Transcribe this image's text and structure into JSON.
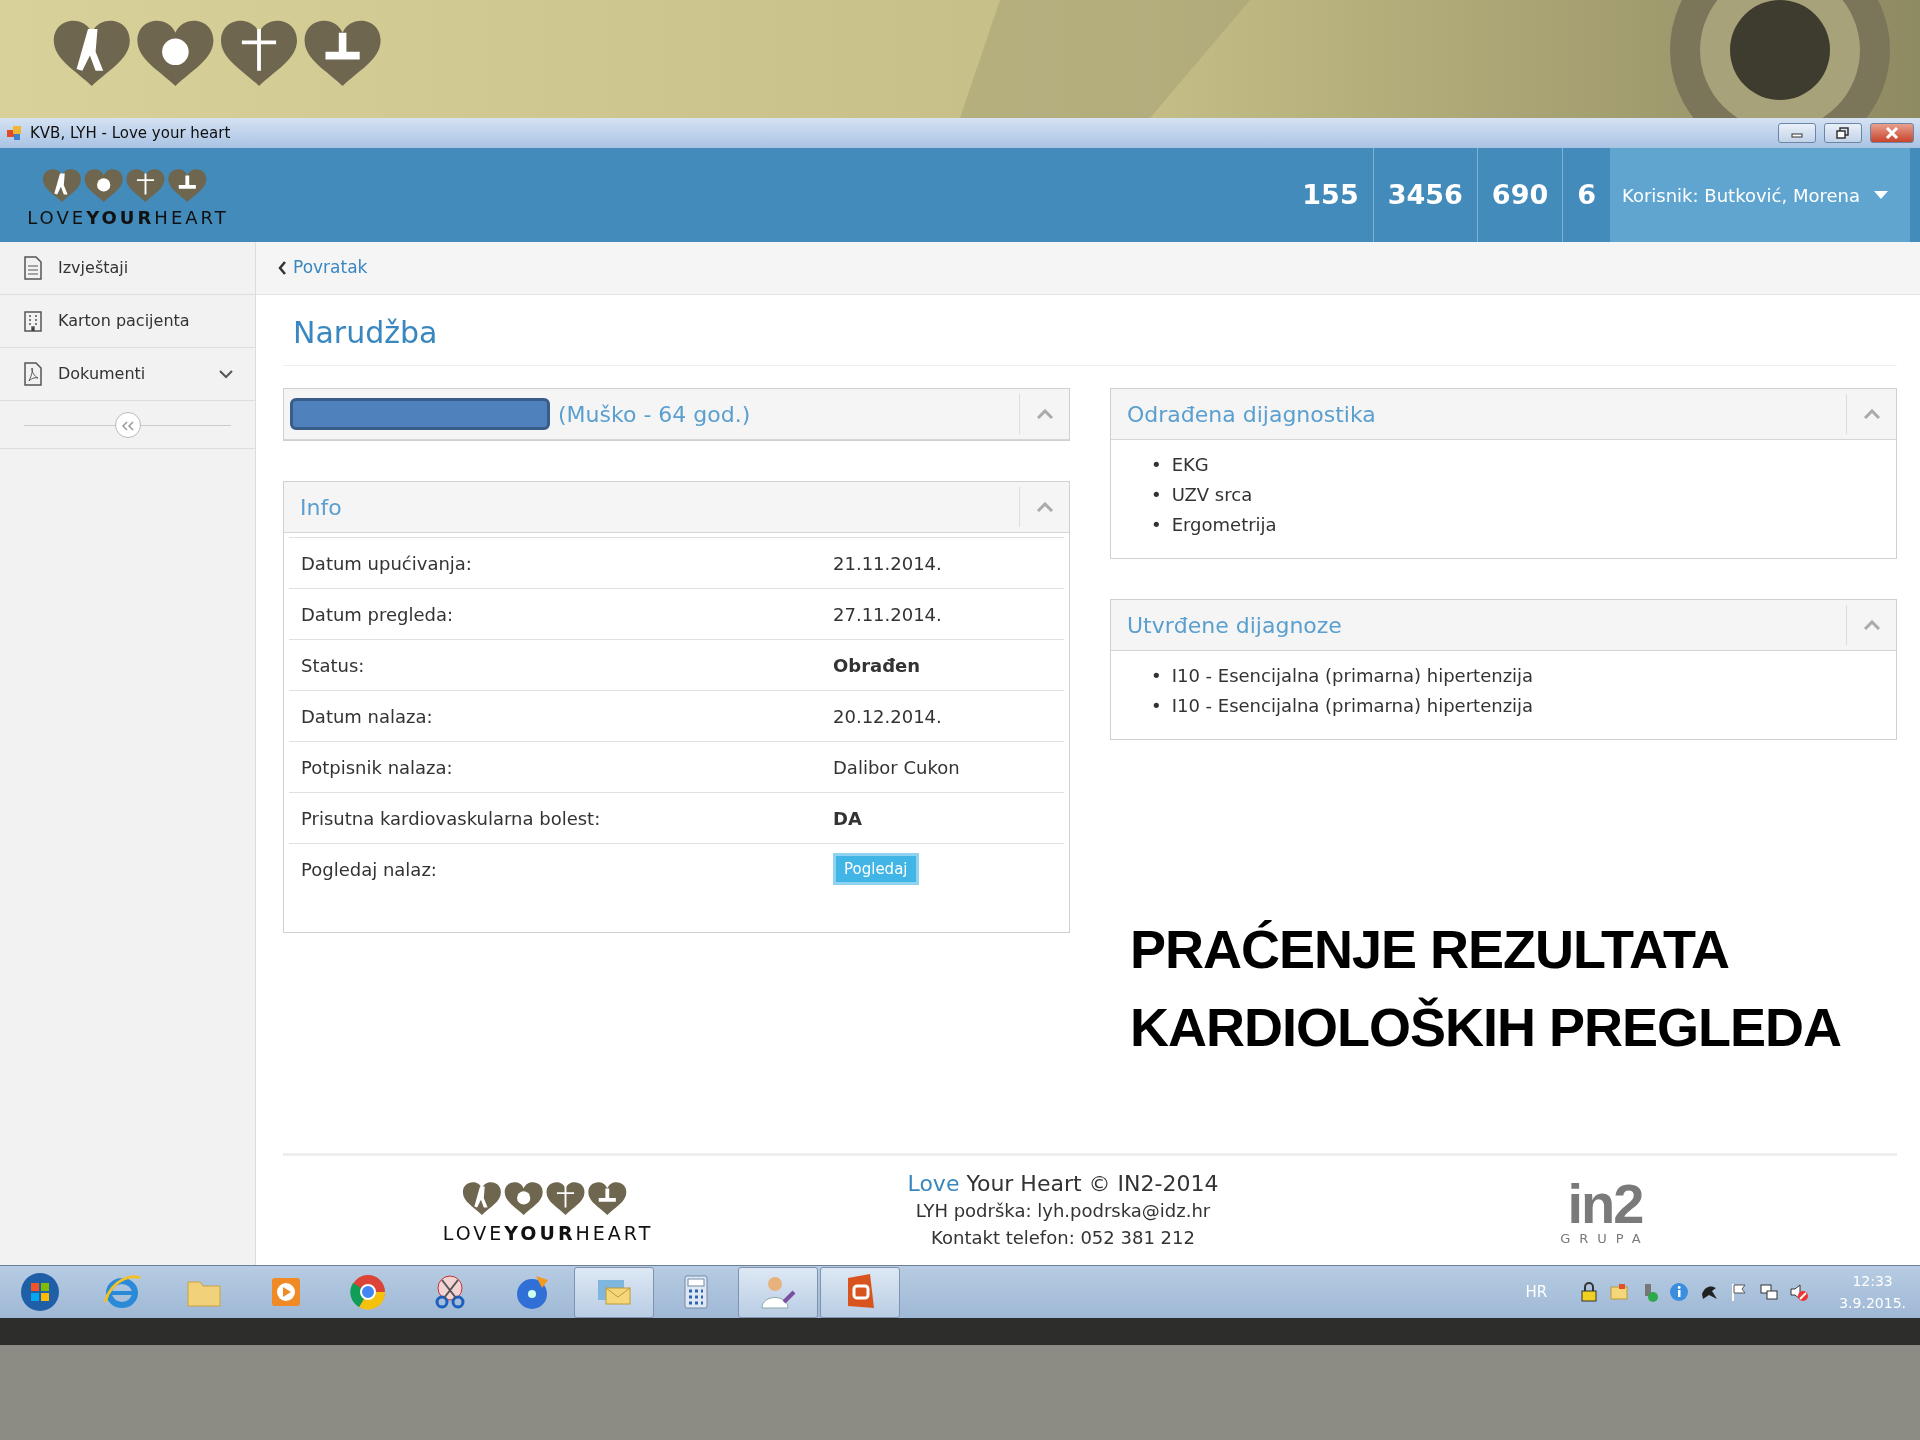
{
  "slide": {
    "caption_lines": [
      "PRAĆENJE REZULTATA",
      "KARDIOLOŠKIH PREGLEDA"
    ]
  },
  "window": {
    "title": "KVB, LYH - Love your heart"
  },
  "header": {
    "logo": "LOVE**YOUR**HEART",
    "counters": [
      "155",
      "3456",
      "690",
      "6"
    ],
    "user": "Korisnik: Butković, Morena"
  },
  "sidebar": {
    "items": [
      {
        "label": "Izvještaji",
        "kind": "document",
        "expandable": false
      },
      {
        "label": "Karton pacijenta",
        "kind": "building",
        "expandable": false
      },
      {
        "label": "Dokumenti",
        "kind": "pdf",
        "expandable": true
      }
    ]
  },
  "breadcrumb": {
    "back": "Povratak"
  },
  "page_title": "Narudžba",
  "patient_panel": {
    "subtitle": "(Muško - 64 god.)"
  },
  "info_panel": {
    "title": "Info",
    "rows": [
      {
        "label": "Datum upućivanja:",
        "value": "21.11.2014.",
        "kind": "text"
      },
      {
        "label": "Datum pregleda:",
        "value": "27.11.2014.",
        "kind": "text"
      },
      {
        "label": "Status:",
        "value": "Obrađen",
        "kind": "bold"
      },
      {
        "label": "Datum nalaza:",
        "value": "20.12.2014.",
        "kind": "text"
      },
      {
        "label": "Potpisnik nalaza:",
        "value": "Dalibor Cukon",
        "kind": "text"
      },
      {
        "label": "Prisutna kardiovaskularna bolest:",
        "value": "DA",
        "kind": "bold"
      },
      {
        "label": "Pogledaj nalaz:",
        "value": "Pogledaj",
        "kind": "button"
      }
    ]
  },
  "right_panels": [
    {
      "title": "Odrađena dijagnostika",
      "items": [
        {
          "bullet": "•",
          "text": "EKG"
        },
        {
          "bullet": "•",
          "text": "UZV srca"
        },
        {
          "bullet": "•",
          "text": "Ergometrija"
        }
      ]
    },
    {
      "title": "Utvrđene dijagnoze",
      "items": [
        {
          "bullet": "•",
          "text": "I10 - Esencijalna (primarna) hipertenzija"
        },
        {
          "bullet": "•",
          "text": "I10 - Esencijalna (primarna) hipertenzija"
        }
      ]
    }
  ],
  "footer": {
    "logo": "LOVE**YOUR**HEART",
    "title_accent": "Love",
    "title": "Your Heart © IN2-2014",
    "lines": [
      "LYH podrška: lyh.podrska@idz.hr",
      "Kontakt telefon: 052 381 212"
    ],
    "partner_mark": "in2",
    "partner_sub": "GRUPA"
  },
  "taskbar": {
    "apps": [
      {
        "kind": "start",
        "running": false
      },
      {
        "kind": "browser",
        "running": false
      },
      {
        "kind": "folder",
        "running": false
      },
      {
        "kind": "media",
        "running": false
      },
      {
        "kind": "chrome",
        "running": false
      },
      {
        "kind": "scissors",
        "running": false
      },
      {
        "kind": "disc",
        "running": false
      },
      {
        "kind": "mail",
        "running": true
      },
      {
        "kind": "calculator",
        "running": false
      },
      {
        "kind": "person",
        "running": true
      },
      {
        "kind": "office",
        "running": true
      }
    ],
    "language": "HR",
    "time": "12:33",
    "date": "3.9.2015."
  }
}
